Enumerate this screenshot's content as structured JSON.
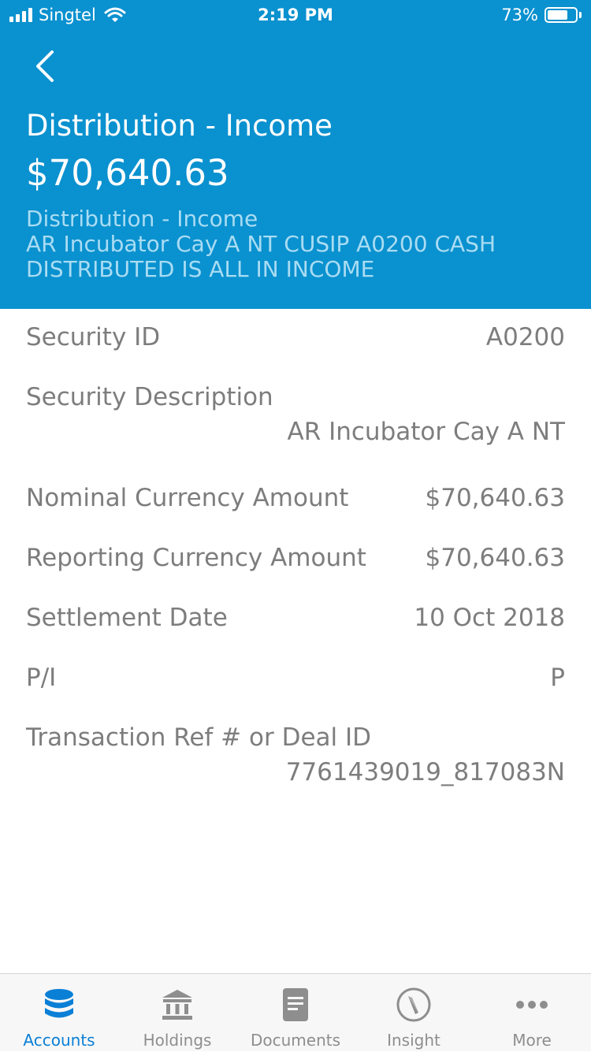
{
  "status_bar": {
    "carrier": "Singtel",
    "time": "2:19 PM",
    "battery_percent": "73%",
    "battery_level": 0.73
  },
  "header": {
    "back_icon": "chevron-left-icon",
    "title": "Distribution - Income",
    "amount": "$70,640.63",
    "description_line1": "Distribution - Income",
    "description_line2": "AR Incubator Cay A NT CUSIP A0200 CASH",
    "description_line3": "DISTRIBUTED IS ALL IN INCOME",
    "background_color": "#0a91cf"
  },
  "details": [
    {
      "label": "Security ID",
      "value": "A0200"
    },
    {
      "label": "Security Description",
      "value": "AR Incubator Cay A NT"
    },
    {
      "label": "Nominal Currency Amount",
      "value": "$70,640.63"
    },
    {
      "label": "Reporting Currency Amount",
      "value": "$70,640.63"
    },
    {
      "label": "Settlement Date",
      "value": "10 Oct 2018"
    },
    {
      "label": "P/I",
      "value": "P"
    },
    {
      "label": "Transaction Ref # or Deal ID",
      "value": "7761439019_817083N"
    }
  ],
  "tabbar": {
    "active_color": "#0a7fd6",
    "tabs": [
      {
        "label": "Accounts",
        "icon": "database-icon",
        "active": true
      },
      {
        "label": "Holdings",
        "icon": "bank-icon",
        "active": false
      },
      {
        "label": "Documents",
        "icon": "document-icon",
        "active": false
      },
      {
        "label": "Insight",
        "icon": "compass-icon",
        "active": false
      },
      {
        "label": "More",
        "icon": "more-dots-icon",
        "active": false
      }
    ]
  }
}
